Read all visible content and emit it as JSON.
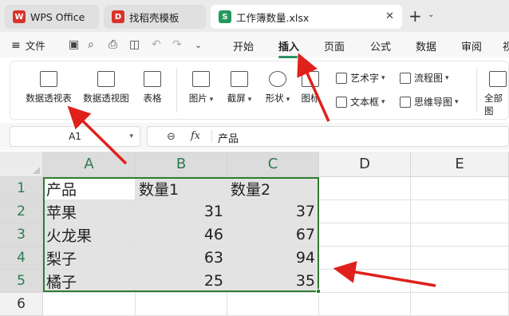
{
  "tabs": [
    {
      "label": "WPS Office",
      "icon": "wps-logo-icon",
      "color": "#d9332b",
      "letter": "W"
    },
    {
      "label": "找稻壳模板",
      "icon": "docer-logo-icon",
      "color": "#d9332b",
      "letter": "D"
    },
    {
      "label": "工作簿数量.xlsx",
      "icon": "spreadsheet-file-icon",
      "color": "#23985d",
      "letter": "S",
      "close": "✕"
    }
  ],
  "new_tab": {
    "plus": "+",
    "caret": "⌄"
  },
  "menu": {
    "hamburger": "≡",
    "file": "文件",
    "tabs": [
      "开始",
      "插入",
      "页面",
      "公式",
      "数据",
      "审阅",
      "视"
    ],
    "active_tab": "插入",
    "accent": "#2b9466"
  },
  "ribbon": {
    "buttons": [
      "数据透视表",
      "数据透视图",
      "表格",
      "图片",
      "截屏",
      "形状",
      "图标",
      "全部图"
    ],
    "small": {
      "art": "艺术字",
      "flow": "流程图",
      "textbox": "文本框",
      "mind": "思维导图"
    }
  },
  "formula_bar": {
    "cell_ref": "A1",
    "fx": "fx",
    "value": "产品"
  },
  "columns": [
    "A",
    "B",
    "C",
    "D",
    "E"
  ],
  "rows": [
    "1",
    "2",
    "3",
    "4",
    "5",
    "6"
  ],
  "table": {
    "header": [
      "产品",
      "数量1",
      "数量2"
    ],
    "data": [
      [
        "苹果",
        "31",
        "37"
      ],
      [
        "火龙果",
        "46",
        "67"
      ],
      [
        "梨子",
        "63",
        "94"
      ],
      [
        "橘子",
        "25",
        "35"
      ]
    ]
  },
  "colors": {
    "selection": "#2e7d32",
    "arrow": "#e0201b"
  }
}
